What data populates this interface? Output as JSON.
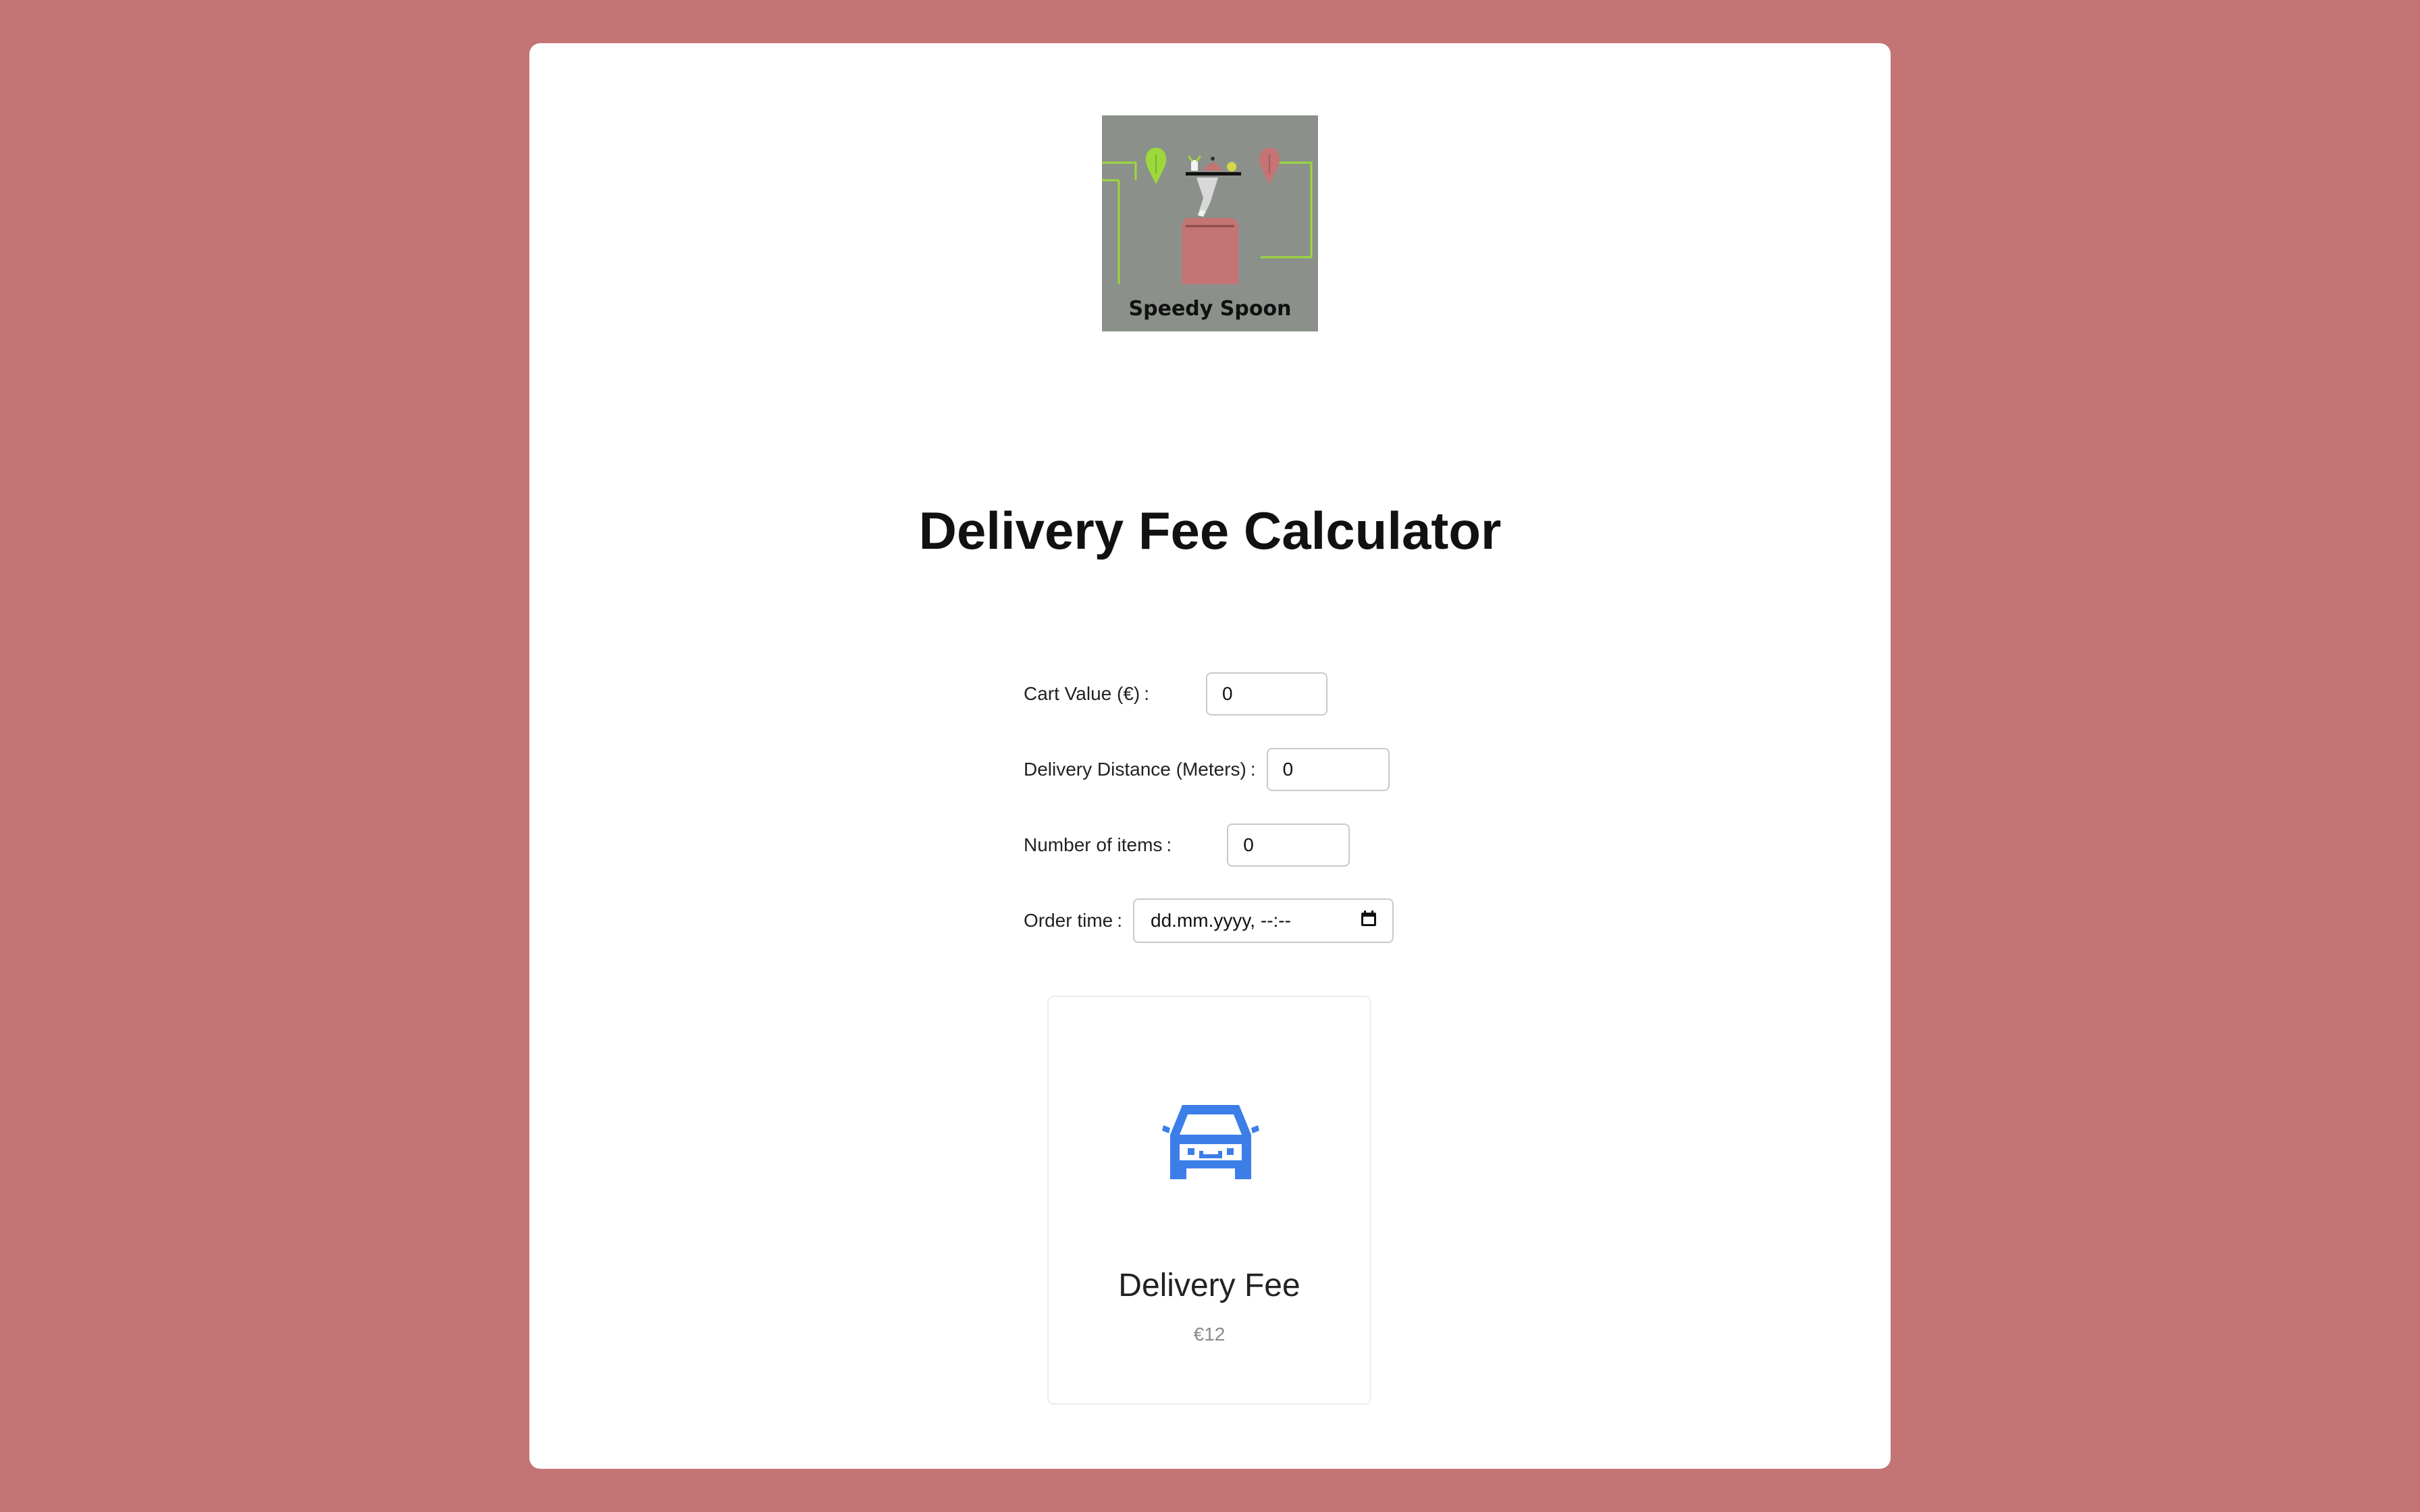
{
  "logo": {
    "brand_name": "Speedy Spoon",
    "colors": {
      "background": "#8b918a",
      "accent_green": "#9cd83c",
      "accent_red": "#c47474"
    }
  },
  "page": {
    "title": "Delivery Fee Calculator",
    "background_color": "#c47474",
    "card_color": "#ffffff"
  },
  "form": {
    "cart_value": {
      "label": "Cart Value (€)",
      "value": "0"
    },
    "delivery_distance": {
      "label": "Delivery Distance (Meters)",
      "value": "0"
    },
    "number_of_items": {
      "label": "Number of items",
      "value": "0"
    },
    "order_time": {
      "label": "Order time",
      "value": "dd.mm.yyyy, --:--",
      "icon": "calendar-icon"
    },
    "label_separator": ":"
  },
  "result": {
    "icon": "car-icon",
    "icon_color": "#3b7ee8",
    "title": "Delivery Fee",
    "value": "€12"
  }
}
